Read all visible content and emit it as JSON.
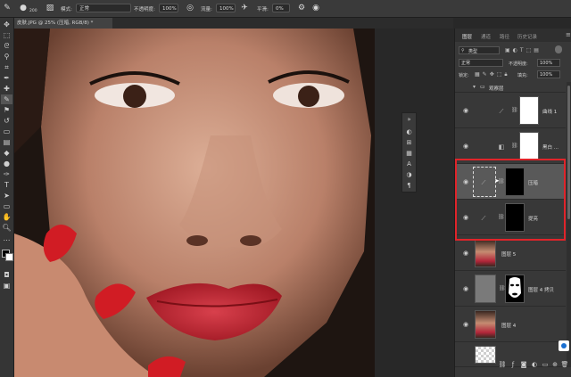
{
  "options_bar": {
    "brush_size": "200",
    "mode_label": "模式:",
    "mode_value": "正常",
    "opacity_label": "不透明度:",
    "opacity_value": "100%",
    "flow_label": "流量:",
    "flow_value": "100%",
    "smoothing_label": "平滑:",
    "smoothing_value": "0%"
  },
  "document": {
    "tab_title": "皮肤.JPG @ 25% (压暗, RGB/8) *"
  },
  "layers_panel": {
    "tabs": [
      "图层",
      "通道",
      "路径",
      "历史记录"
    ],
    "kind_filter": "类型",
    "blend_mode": "正常",
    "opacity_label": "不透明度:",
    "opacity_value": "100%",
    "fill_label": "填充:",
    "fill_value": "100%",
    "lock_label": "锁定:",
    "layers": [
      {
        "name": "观察层",
        "type": "group"
      },
      {
        "name": "曲线 1",
        "type": "curves"
      },
      {
        "name": "黑白 ...",
        "type": "black-white"
      },
      {
        "name": "压暗",
        "type": "curves",
        "selected": true
      },
      {
        "name": "提亮",
        "type": "curves"
      },
      {
        "name": "图层 5",
        "type": "pixel"
      },
      {
        "name": "图层 4 拷贝",
        "type": "pixel-mask"
      },
      {
        "name": "图层 4",
        "type": "pixel"
      }
    ]
  },
  "colors": {
    "highlight_red": "#e0242a",
    "panel_bg": "#383838",
    "selected_row": "#595959"
  }
}
